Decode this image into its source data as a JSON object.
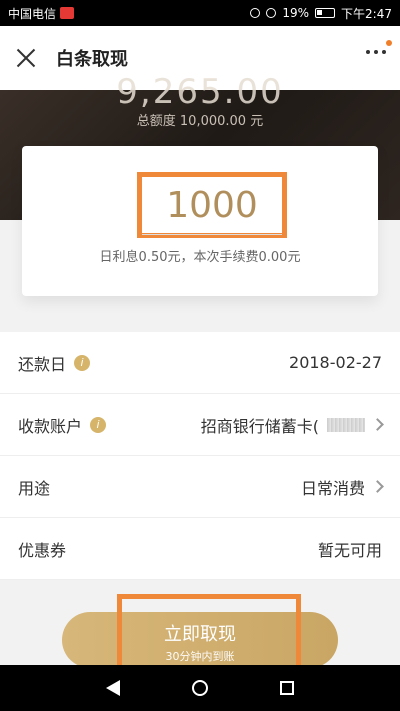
{
  "status": {
    "carrier": "中国电信",
    "battery": "19%",
    "time": "下午2:47"
  },
  "header": {
    "title": "白条取现"
  },
  "hero": {
    "available_partial": "9,265.00",
    "total_limit": "总额度 10,000.00 元"
  },
  "amount": {
    "value": "1000",
    "fee_note": "日利息0.50元，本次手续费0.00元"
  },
  "rows": [
    {
      "label": "还款日",
      "value": "2018-02-27"
    },
    {
      "label": "收款账户",
      "value": "招商银行储蓄卡("
    },
    {
      "label": "用途",
      "value": "日常消费"
    },
    {
      "label": "优惠券",
      "value": "暂无可用"
    }
  ],
  "button": {
    "label": "立即取现",
    "sub": "30分钟内到账"
  },
  "colors": {
    "accent": "#c9a664",
    "highlight": "#f0883a"
  }
}
